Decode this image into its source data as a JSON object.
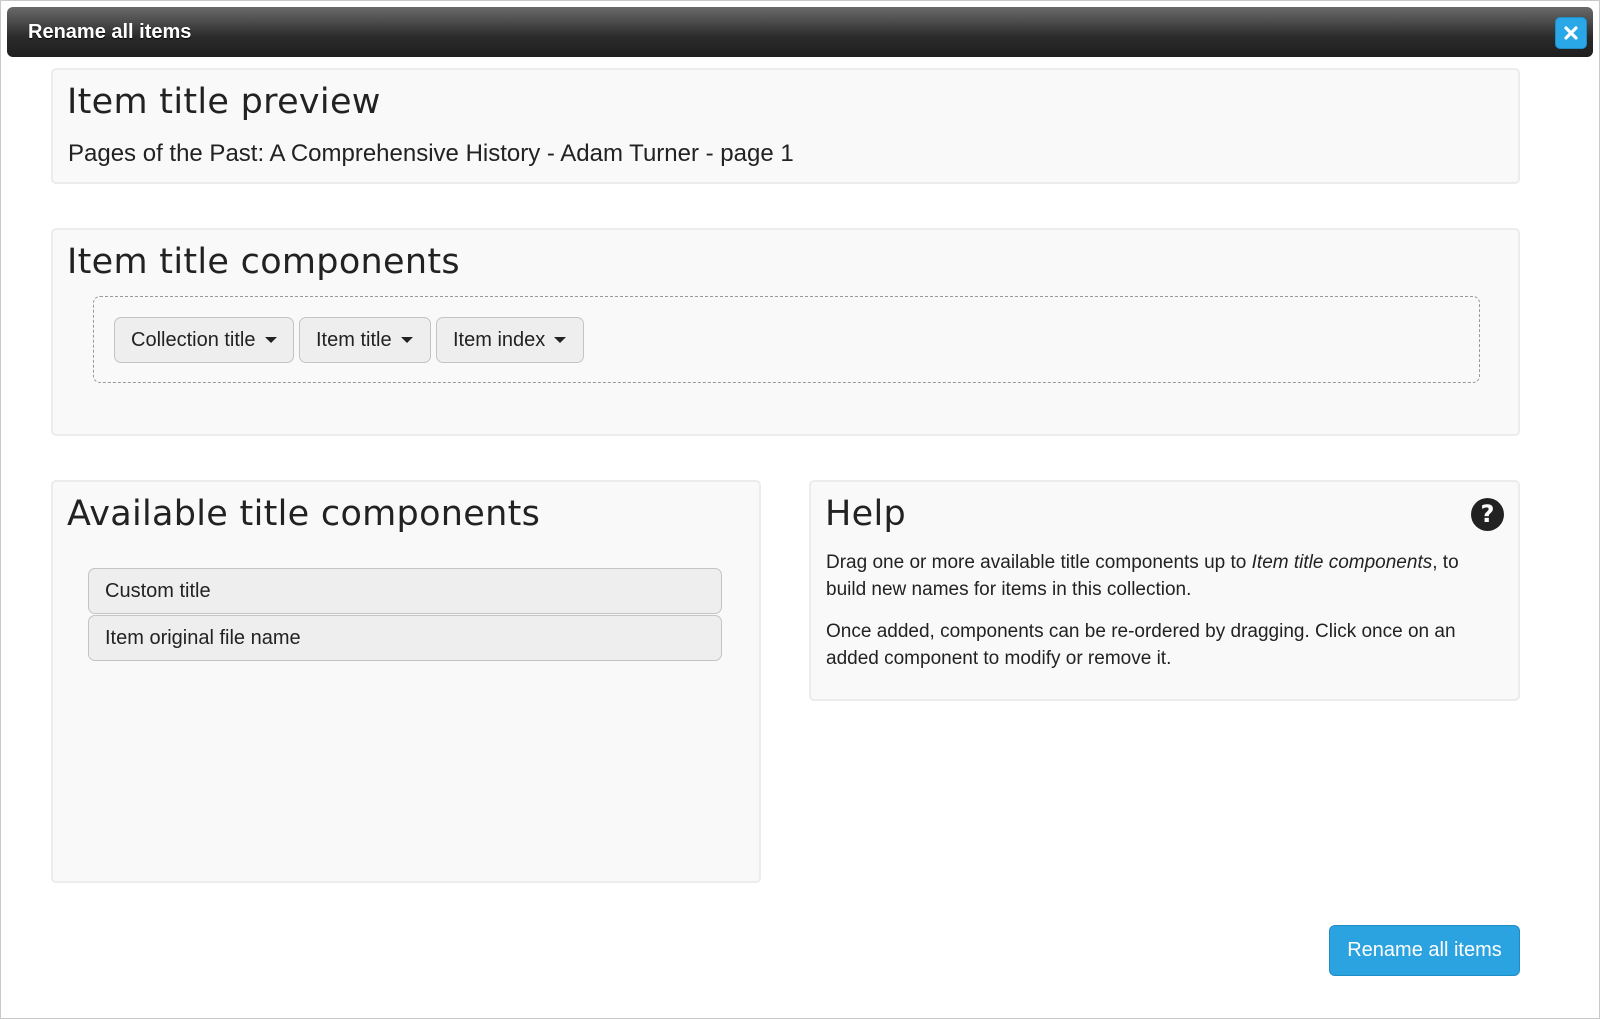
{
  "dialog": {
    "title": "Rename all items",
    "close_icon": "close-icon",
    "accent_color": "#2aa7e6"
  },
  "preview": {
    "heading": "Item title preview",
    "text": "Pages of the Past: A Comprehensive History - Adam Turner - page 1"
  },
  "components": {
    "heading": "Item title components",
    "chips": [
      {
        "label": "Collection title"
      },
      {
        "label": "Item title"
      },
      {
        "label": "Item index"
      }
    ]
  },
  "available": {
    "heading": "Available title components",
    "items": [
      {
        "label": "Custom title"
      },
      {
        "label": "Item original file name"
      }
    ]
  },
  "help": {
    "heading": "Help",
    "icon": "question-icon",
    "p1_before": "Drag one or more available title components up to ",
    "p1_emph": "Item title components",
    "p1_after": ", to build new names for items in this collection.",
    "p2": "Once added, components can be re-ordered by dragging. Click once on an added component to modify or remove it."
  },
  "footer": {
    "rename_label": "Rename all items"
  }
}
